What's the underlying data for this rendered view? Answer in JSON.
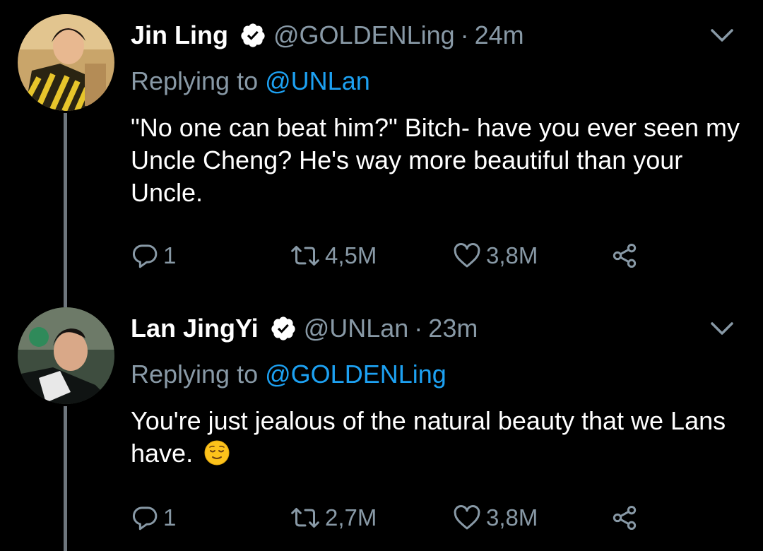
{
  "tweets": [
    {
      "display_name": "Jin Ling",
      "handle": "@GOLDENLing",
      "separator": "·",
      "time": "24m",
      "replying_prefix": "Replying to",
      "replying_handle": "@UNLan",
      "body": "\"No one can beat him?\" Bitch- have you ever seen my Uncle Cheng? He's way more beautiful than your Uncle.",
      "emoji": "",
      "replies": "1",
      "retweets": "4,5M",
      "likes": "3,8M"
    },
    {
      "display_name": "Lan JingYi",
      "handle": "@UNLan",
      "separator": "·",
      "time": "23m",
      "replying_prefix": "Replying to",
      "replying_handle": "@GOLDENLing",
      "body": "You're just jealous of the natural beauty that we Lans have.",
      "emoji": "relieved-face",
      "replies": "1",
      "retweets": "2,7M",
      "likes": "3,8M"
    }
  ],
  "icons": {
    "verified": "verified-badge-icon",
    "more": "chevron-down-icon",
    "reply": "reply-icon",
    "retweet": "retweet-icon",
    "like": "heart-icon",
    "share": "share-icon"
  },
  "colors": {
    "background": "#000000",
    "text": "#ffffff",
    "muted": "#8899a6",
    "link": "#1da1f2",
    "thread_line": "#6e767d"
  }
}
